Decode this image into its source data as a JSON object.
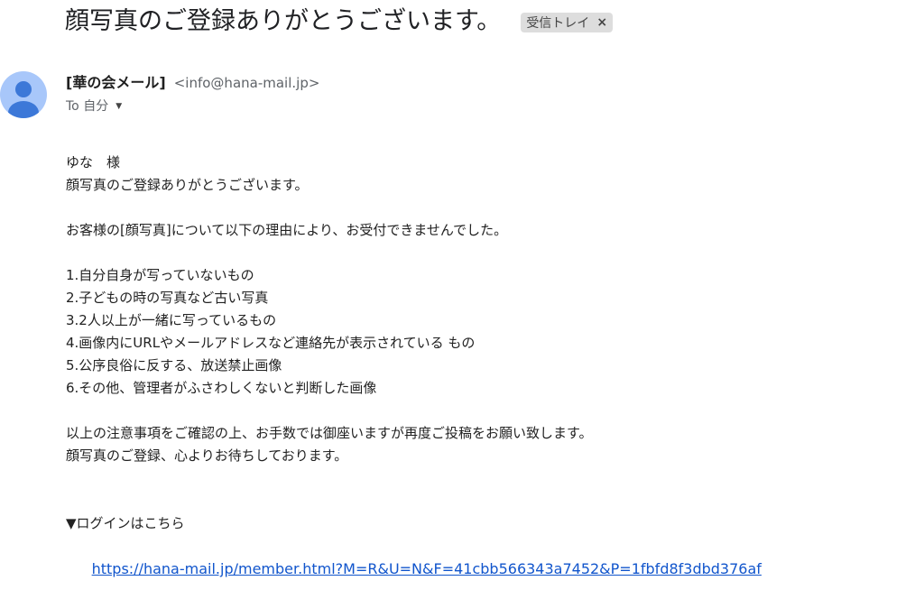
{
  "email": {
    "subject": "顔写真のご登録ありがとうございます。",
    "label": "受信トレイ",
    "label_close": "×",
    "sender": {
      "name": "[華の会メール]",
      "email": "<info@hana-mail.jp>"
    },
    "to": "To 自分",
    "body": {
      "greeting": "ゆな　様",
      "thanks": "顔写真のご登録ありがとうございます。",
      "reason_intro": "お客様の[顔写真]について以下の理由により、お受付できませんでした。",
      "reasons": [
        "1.自分自身が写っていないもの",
        "2.子どもの時の写真など古い写真",
        "3.2人以上が一緒に写っているもの",
        "4.画像内にURLやメールアドレスなど連絡先が表示されている もの",
        "5.公序良俗に反する、放送禁止画像",
        "6.その他、管理者がふさわしくないと判断した画像"
      ],
      "closing_1": "以上の注意事項をご確認の上、お手数では御座いますが再度ご投稿をお願い致します。",
      "closing_2": "顔写真のご登録、心よりお待ちしております。",
      "login_label": "▼ログインはこちら",
      "login_link": "https://hana-mail.jp/member.html?M=R&U=N&F=41cbb566343a7452&P=1fbfd8f3dbd376af"
    }
  },
  "colors": {
    "avatar_bg": "#a8c7fa",
    "avatar_fg": "#3c78d8",
    "link": "#1155cc",
    "chip_bg": "#dddddd"
  }
}
